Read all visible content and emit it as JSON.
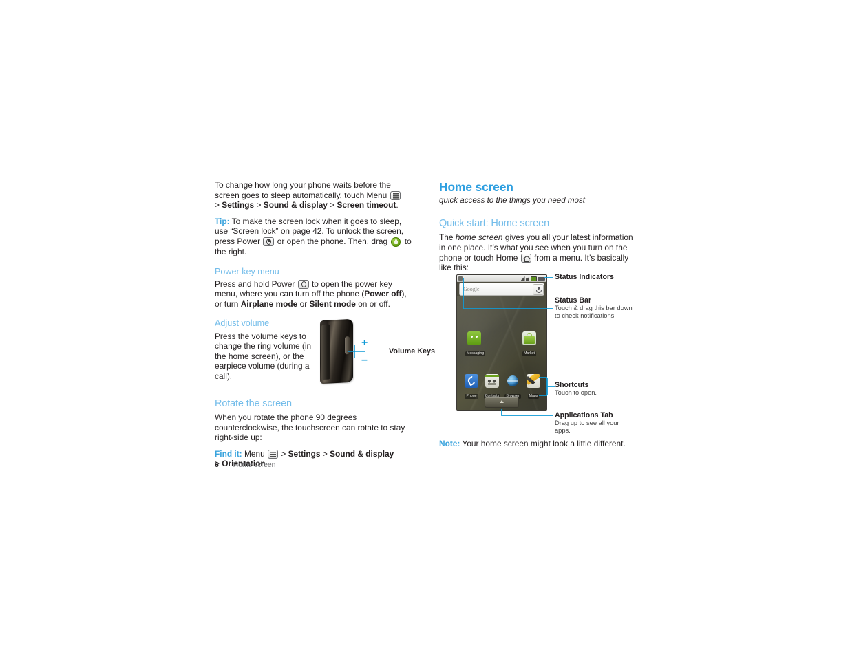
{
  "left_column": {
    "intro": {
      "text_before_menu": "To change how long your phone waits before the screen goes to sleep automatically, touch Menu",
      "menu_icon": "menu-key-icon",
      "path_gt1": ">",
      "path_settings": "Settings",
      "path_gt2": ">",
      "path_sound_display": "Sound & display",
      "path_gt3": ">",
      "path_screen_timeout": "Screen timeout",
      "path_period": "."
    },
    "tip": {
      "label": "Tip:",
      "text_part1": "To make the screen lock when it goes to sleep, use “Screen lock” on page 42. To unlock the screen, press Power",
      "power_icon": "power-key-icon",
      "text_part2": "or open the phone. Then, drag",
      "lock_icon": "green-lock-icon",
      "text_part3": "to the right."
    },
    "power_key_menu": {
      "heading": "Power key menu",
      "text_part1": "Press and hold Power",
      "power_icon": "power-key-icon",
      "text_part2": "to open the power key menu, where you can turn off the phone (",
      "bold_power_off": "Power off",
      "text_part3": "), or turn",
      "bold_airplane": "Airplane mode",
      "text_or": "or",
      "bold_silent": "Silent mode",
      "text_part4": "on or off."
    },
    "adjust_volume": {
      "heading": "Adjust volume",
      "body": "Press the volume keys to change the ring volume (in the home screen), or the earpiece volume (during a call).",
      "figure": {
        "label": "Volume Keys",
        "plus": "+",
        "minus": "–"
      }
    },
    "rotate_screen": {
      "heading": "Rotate the screen",
      "body": "When you rotate the phone 90 degrees counterclockwise, the touchscreen can rotate to stay right-side up:",
      "find_it_label": "Find it:",
      "find_it_menu": "Menu",
      "menu_icon": "menu-key-icon",
      "find_it_gt1": ">",
      "find_it_settings": "Settings",
      "find_it_gt2": ">",
      "find_it_sound_display": "Sound & display",
      "find_it_gt3": ">",
      "find_it_orientation": "Orientation"
    }
  },
  "right_column": {
    "title": "Home screen",
    "subtitle": "quick access to the things you need most",
    "quick_start_heading": "Quick start: Home screen",
    "body_part1": "The",
    "body_italic": "home screen",
    "body_part2": "gives you all your latest information in one place. It’s what you see when you turn on the phone or touch Home",
    "home_icon": "home-key-icon",
    "body_part3": "from a menu. It’s basically like this:",
    "note": {
      "label": "Note:",
      "text": "Your home screen might look a little different."
    },
    "callouts": [
      {
        "id": "status-indicators",
        "title": "Status Indicators",
        "desc": ""
      },
      {
        "id": "status-bar",
        "title": "Status Bar",
        "desc": "Touch & drag this bar down to check notifications."
      },
      {
        "id": "shortcuts",
        "title": "Shortcuts",
        "desc": "Touch to open."
      },
      {
        "id": "applications-tab",
        "title": "Applications Tab",
        "desc": "Drag up to see all your apps."
      }
    ],
    "phone_screen": {
      "search_placeholder": "Google",
      "search_icon": "magnifier-icon",
      "mic_icon": "microphone-icon",
      "apps": [
        {
          "name": "Messaging",
          "icon": "messaging-icon"
        },
        {
          "name": "Market",
          "icon": "market-icon"
        }
      ],
      "shortcuts": [
        {
          "name": "Phone",
          "icon": "phone-icon"
        },
        {
          "name": "Contacts",
          "icon": "contacts-icon"
        },
        {
          "name": "Browser",
          "icon": "browser-globe-icon"
        },
        {
          "name": "Maps",
          "icon": "maps-icon"
        }
      ],
      "applications_tab_icon": "up-arrow-tab-icon"
    }
  },
  "footer": {
    "page_number": "6",
    "section": "Home screen"
  },
  "colors": {
    "heading_blue": "#2e9fe0",
    "subheading_blue": "#74bdea",
    "accent_blue": "#39a3dd",
    "leader_blue": "#0f9ad6",
    "body_text": "#231f20"
  }
}
